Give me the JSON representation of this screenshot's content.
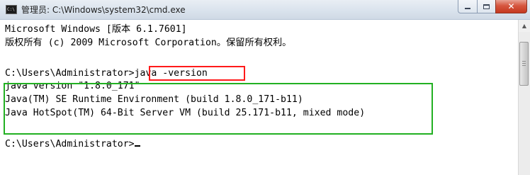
{
  "window": {
    "title": "管理员: C:\\Windows\\system32\\cmd.exe",
    "icon": "cmd-icon",
    "icon_text": "C:\\",
    "controls": {
      "minimize": "minimize-icon",
      "maximize": "maximize-icon",
      "close": "close-icon",
      "close_glyph": "✕"
    }
  },
  "console": {
    "lines": [
      "Microsoft Windows [版本 6.1.7601]",
      "版权所有 (c) 2009 Microsoft Corporation。保留所有权利。",
      "",
      "C:\\Users\\Administrator>java -version",
      "java version \"1.8.0_171\"",
      "Java(TM) SE Runtime Environment (build 1.8.0_171-b11)",
      "Java HotSpot(TM) 64-Bit Server VM (build 25.171-b11, mixed mode)",
      "",
      "C:\\Users\\Administrator>"
    ],
    "highlight_command_color": "#ff1a1a",
    "highlight_output_color": "#22b022"
  },
  "scrollbar": {
    "up_arrow": "▲"
  }
}
